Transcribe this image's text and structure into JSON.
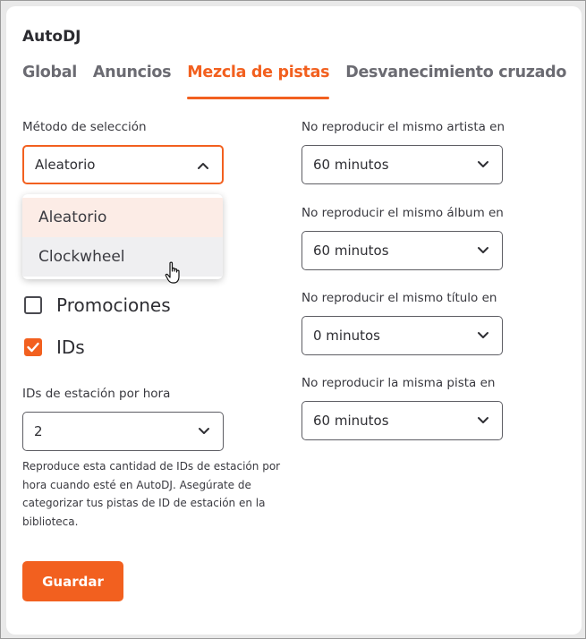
{
  "app_title": "AutoDJ",
  "tabs": [
    {
      "label": "Global",
      "active": false
    },
    {
      "label": "Anuncios",
      "active": false
    },
    {
      "label": "Mezcla de pistas",
      "active": true
    },
    {
      "label": "Desvanecimiento cruzado",
      "active": false
    }
  ],
  "selection": {
    "label": "Método de selección",
    "value": "Aleatorio",
    "options": [
      "Aleatorio",
      "Clockwheel"
    ],
    "hovered_option": "Clockwheel"
  },
  "checkboxes": [
    {
      "label": "Promociones",
      "checked": false
    },
    {
      "label": "IDs",
      "checked": true
    }
  ],
  "station_ids": {
    "label": "IDs de estación por hora",
    "value": "2",
    "help": "Reproduce esta cantidad de IDs de estación por hora cuando esté en AutoDJ. Asegúrate de categorizar tus pistas de ID de estación en la biblioteca."
  },
  "repeat_rules": [
    {
      "label": "No reproducir el mismo artista en",
      "value": "60 minutos"
    },
    {
      "label": "No reproducir el mismo álbum en",
      "value": "60 minutos"
    },
    {
      "label": "No reproducir el mismo título en",
      "value": "0 minutos"
    },
    {
      "label": "No reproducir la misma pista en",
      "value": "60 minutos"
    }
  ],
  "save_label": "Guardar",
  "colors": {
    "accent": "#f2601f",
    "text": "#2e2e33",
    "muted_tab": "#6b6b72"
  }
}
